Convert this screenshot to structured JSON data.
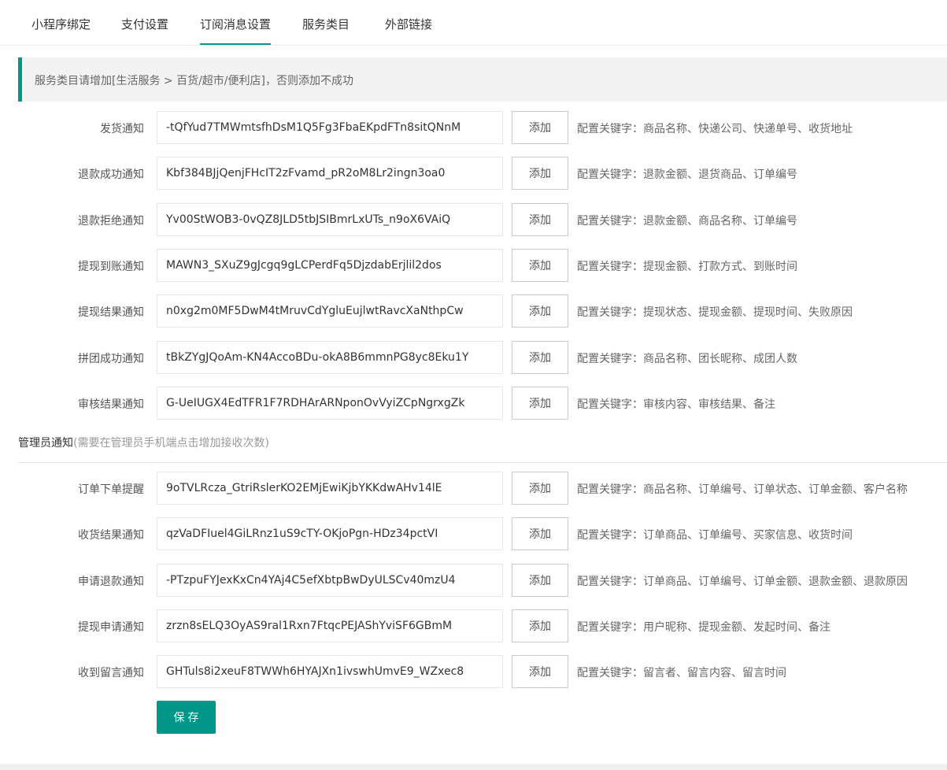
{
  "tabs": [
    {
      "label": "小程序绑定"
    },
    {
      "label": "支付设置"
    },
    {
      "label": "订阅消息设置"
    },
    {
      "label": "服务类目"
    },
    {
      "label": "外部链接"
    }
  ],
  "active_tab": "订阅消息设置",
  "notice": "服务类目请增加[生活服务 > 百货/超市/便利店]，否则添加不成功",
  "user_rows": [
    {
      "label": "发货通知",
      "value": "-tQfYud7TMWmtsfhDsM1Q5Fg3FbaEKpdFTn8sitQNnM",
      "button": "添加",
      "keywords": "配置关键字：商品名称、快递公司、快递单号、收货地址"
    },
    {
      "label": "退款成功通知",
      "value": "Kbf384BJjQenjFHcIT2zFvamd_pR2oM8Lr2ingn3oa0",
      "button": "添加",
      "keywords": "配置关键字：退款金额、退货商品、订单编号"
    },
    {
      "label": "退款拒绝通知",
      "value": "Yv00StWOB3-0vQZ8JLD5tbJSIBmrLxUTs_n9oX6VAiQ",
      "button": "添加",
      "keywords": "配置关键字：退款金额、商品名称、订单编号"
    },
    {
      "label": "提现到账通知",
      "value": "MAWN3_SXuZ9gJcgq9gLCPerdFq5DjzdabErjlil2dos",
      "button": "添加",
      "keywords": "配置关键字：提现金额、打款方式、到账时间"
    },
    {
      "label": "提现结果通知",
      "value": "n0xg2m0MF5DwM4tMruvCdYgluEujlwtRavcXaNthpCw",
      "button": "添加",
      "keywords": "配置关键字：提现状态、提现金额、提现时间、失败原因"
    },
    {
      "label": "拼团成功通知",
      "value": "tBkZYgJQoAm-KN4AccoBDu-okA8B6mmnPG8yc8Eku1Y",
      "button": "添加",
      "keywords": "配置关键字：商品名称、团长昵称、成团人数"
    },
    {
      "label": "审核结果通知",
      "value": "G-UeIUGX4EdTFR1F7RDHArARNponOvVyiZCpNgrxgZk",
      "button": "添加",
      "keywords": "配置关键字：审核内容、审核结果、备注"
    }
  ],
  "admin_section": {
    "title": "管理员通知",
    "hint": "(需要在管理员手机端点击增加接收次数)"
  },
  "admin_rows": [
    {
      "label": "订单下单提醒",
      "value": "9oTVLRcza_GtriRslerKO2EMjEwiKjbYKKdwAHv14lE",
      "button": "添加",
      "keywords": "配置关键字：商品名称、订单编号、订单状态、订单金额、客户名称"
    },
    {
      "label": "收货结果通知",
      "value": "qzVaDFIuel4GiLRnz1uS9cTY-OKjoPgn-HDz34pctVI",
      "button": "添加",
      "keywords": "配置关键字：订单商品、订单编号、买家信息、收货时间"
    },
    {
      "label": "申请退款通知",
      "value": "-PTzpuFYJexKxCn4YAj4C5efXbtpBwDyULSCv40mzU4",
      "button": "添加",
      "keywords": "配置关键字：订单商品、订单编号、订单金额、退款金额、退款原因"
    },
    {
      "label": "提现申请通知",
      "value": "zrzn8sELQ3OyAS9ral1Rxn7FtqcPEJAShYviSF6GBmM",
      "button": "添加",
      "keywords": "配置关键字：用户昵称、提现金额、发起时间、备注"
    },
    {
      "label": "收到留言通知",
      "value": "GHTuls8i2xeuF8TWWh6HYAJXn1ivswhUmvE9_WZxec8",
      "button": "添加",
      "keywords": "配置关键字：留言者、留言内容、留言时间"
    }
  ],
  "save_label": "保存",
  "colors": {
    "accent": "#009688",
    "notice_bg": "#f2f2f2"
  }
}
